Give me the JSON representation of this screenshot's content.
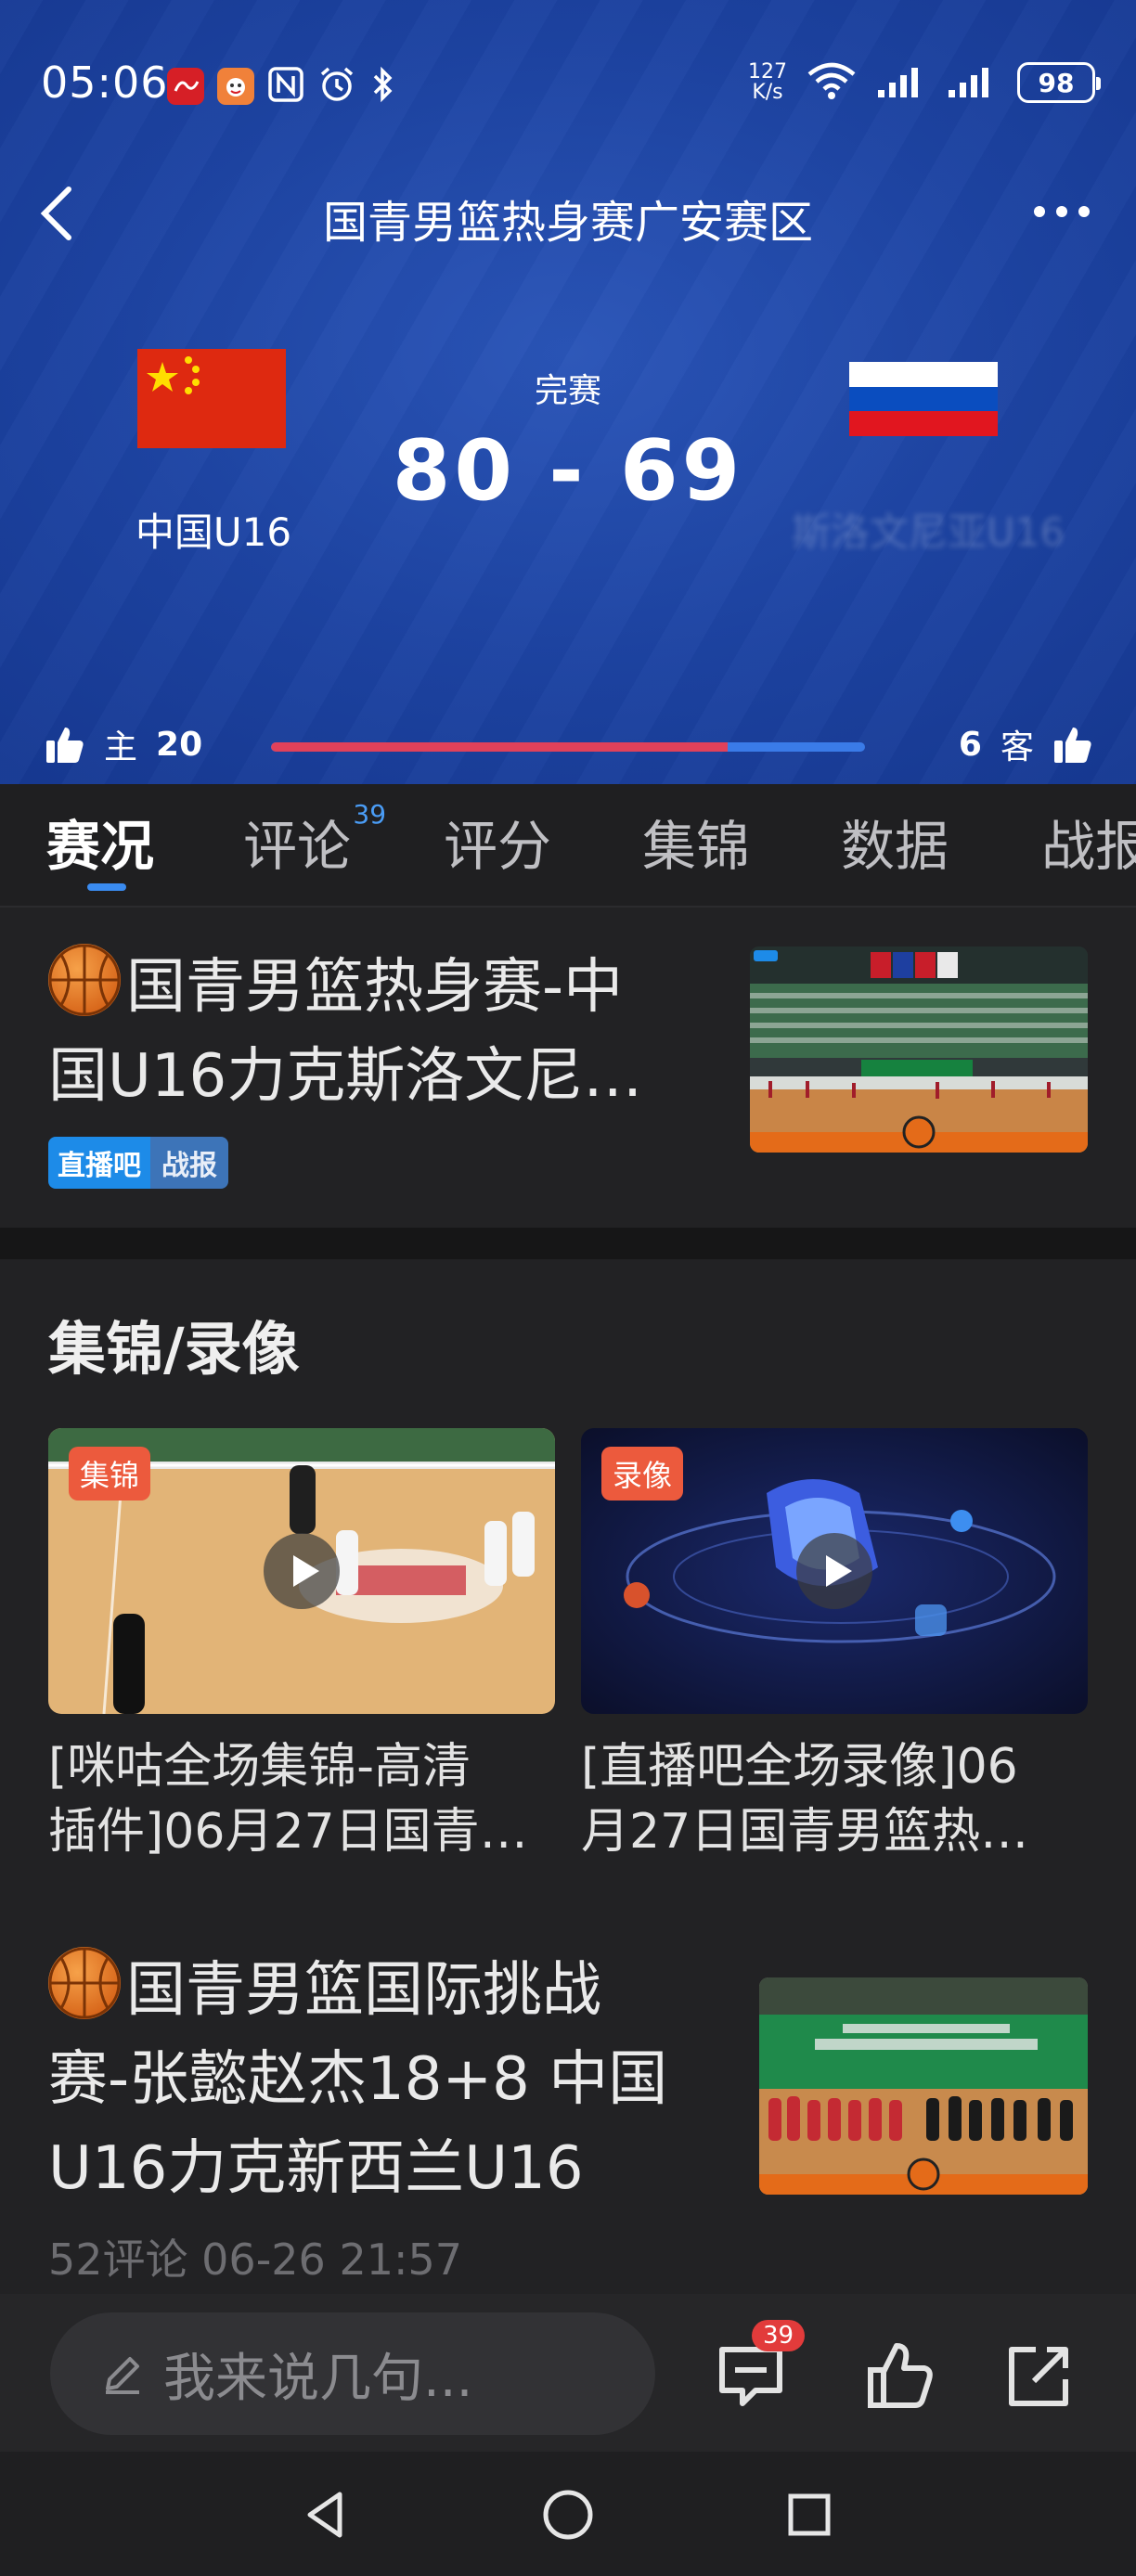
{
  "status_bar": {
    "time": "05:06",
    "net_speed_value": "127",
    "net_speed_unit": "K/s",
    "battery": "98",
    "icons": [
      "app-icon-1",
      "app-icon-2",
      "nfc-icon",
      "alarm-icon",
      "bluetooth-icon",
      "wifi-icon",
      "signal-icon",
      "signal-icon-2"
    ]
  },
  "header": {
    "title": "国青男篮热身赛广安赛区",
    "status": "完赛",
    "score": "80 - 69",
    "home_team": "中国U16",
    "away_team": "斯洛文尼亚U16",
    "home_like_label": "主",
    "home_likes": "20",
    "away_like_label": "客",
    "away_likes": "6",
    "home_like_share": 0.769,
    "colors": {
      "home_bar": "#e0415a",
      "away_bar": "#3a7be8",
      "header_bg": "#1d43a2"
    }
  },
  "tabs": {
    "items": [
      {
        "label": "赛况",
        "active": true
      },
      {
        "label": "评论",
        "badge": "39"
      },
      {
        "label": "评分"
      },
      {
        "label": "集锦"
      },
      {
        "label": "数据"
      },
      {
        "label": "战报"
      }
    ]
  },
  "news1": {
    "title_line1": "国青男篮热身赛-中",
    "title_line2": "国U16力克斯洛文尼…",
    "tag_source": "直播吧",
    "tag_type": "战报"
  },
  "highlights": {
    "section_title": "集锦/录像",
    "videos": [
      {
        "tag": "集锦",
        "title_line1": "[咪咕全场集锦-高清",
        "title_line2": "插件]06月27日国青…"
      },
      {
        "tag": "录像",
        "title_line1": "[直播吧全场录像]06",
        "title_line2": "月27日国青男篮热…"
      }
    ]
  },
  "news2": {
    "title_line1": "国青男篮国际挑战",
    "title_line2": "赛-张懿赵杰18+8 中国",
    "title_line3": "U16力克新西兰U16",
    "meta": "52评论 06-26 21:57"
  },
  "bottom_bar": {
    "comment_placeholder": "我来说几句...",
    "comment_count": "39"
  }
}
